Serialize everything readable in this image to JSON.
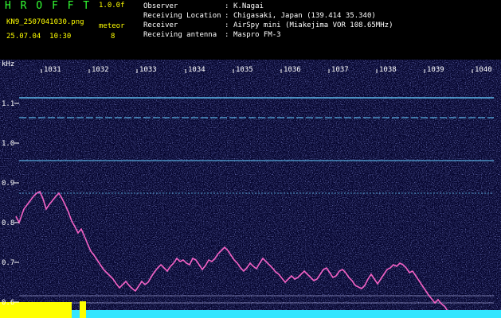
{
  "header": {
    "app_title": "H R O F F T",
    "version": "1.0.0f",
    "filename": "KN9_2507041030.png",
    "datetime": "25.07.04  10:30",
    "meteor_label": "meteor",
    "meteor_count": "8",
    "meta": [
      {
        "key": "Observer",
        "value": "K.Nagai"
      },
      {
        "key": "Receiving Location",
        "value": "Chigasaki, Japan (139.414 35.340)"
      },
      {
        "key": "Receiver",
        "value": "AirSpy mini (Miakejima VOR 108.65MHz)"
      },
      {
        "key": "Receiving antenna",
        "value": "Maspro FM-3"
      }
    ],
    "separator": ":"
  },
  "spectrogram": {
    "y_unit": "kHz",
    "x_ticks": [
      "1031",
      "1032",
      "1033",
      "1034",
      "1035",
      "1036",
      "1037",
      "1038",
      "1039",
      "1040"
    ],
    "y_ticks": [
      "1.1",
      "1.0",
      "0.9",
      "0.8",
      "0.7",
      "0.6"
    ],
    "colors": {
      "background": "#05052e",
      "trace": "#ff66cc",
      "carrier": "#66ccff",
      "bottom_bar": "#33e6ff",
      "yellow_block": "#ffff00"
    }
  }
}
